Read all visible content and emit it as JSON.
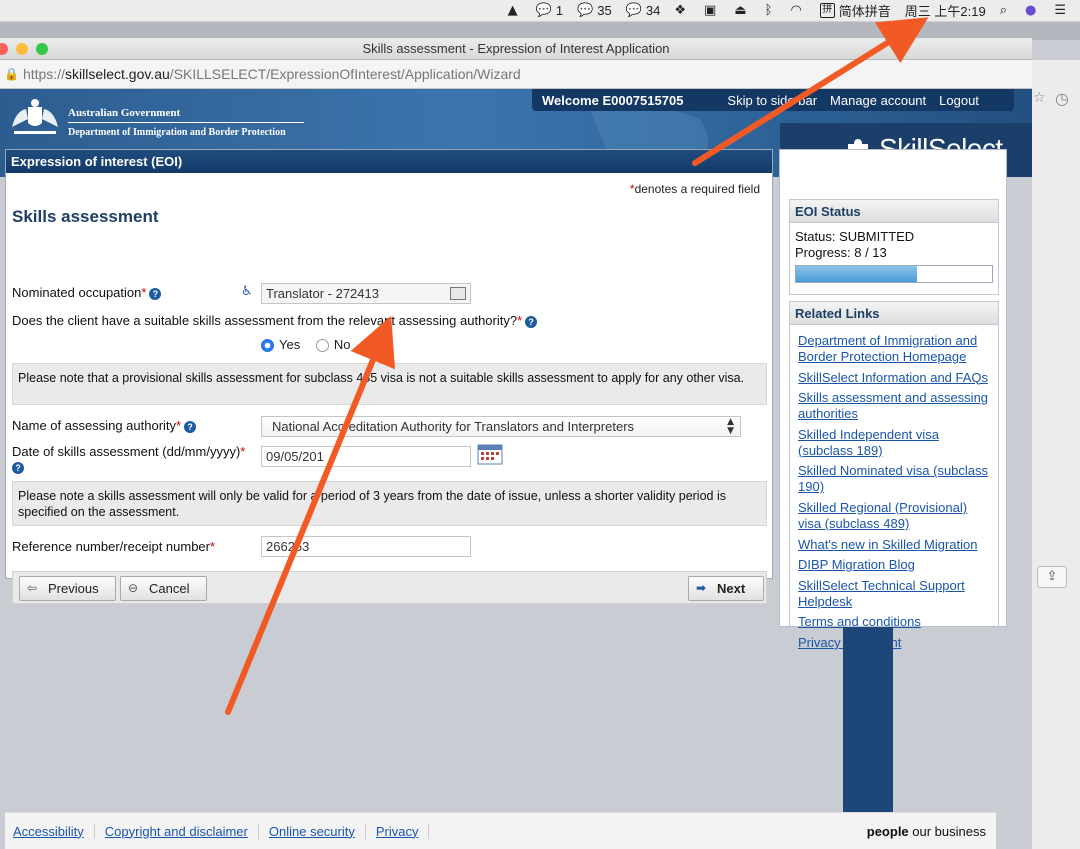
{
  "menubar": {
    "wechat_1": "1",
    "wechat_2": "35",
    "wechat_3": "34",
    "ime_glyph": "拼",
    "ime": "简体拼音",
    "clock": "周三 上午2:19"
  },
  "window": {
    "title": "Skills assessment - Expression of Interest Application",
    "url_scheme": "https://",
    "url_host": "skillselect.gov.au",
    "url_path": "/SKILLSELECT/ExpressionOfInterest/Application/Wizard"
  },
  "banner": {
    "govt": "Australian Government",
    "dept": "Department of Immigration and Border Protection",
    "welcome": "Welcome E0007515705",
    "links": [
      "Skip to side bar",
      "Manage account",
      "Logout"
    ],
    "brand": "SkillSelect"
  },
  "form": {
    "panel_title": "Expression of interest (EOI)",
    "required_note": "denotes a required field",
    "required_mark": "*",
    "section_title": "Skills assessment",
    "nominated_label": "Nominated occupation",
    "nominated_value": "Translator - 272413",
    "question": "Does the client have a suitable skills assessment from the relevant assessing authority?",
    "yes_label": "Yes",
    "no_label": "No",
    "yes_selected": true,
    "note1": "Please note that a provisional skills assessment for subclass 485 visa is not a suitable skills assessment to apply for any other visa.",
    "authority_label": "Name of assessing authority",
    "authority_value": "National Accreditation Authority for Translators and Interpreters",
    "date_label": "Date of skills assessment (dd/mm/yyyy)",
    "date_value": "09/05/201",
    "note2": "Please note a skills assessment will only be valid for a period of 3 years from the date of issue, unless a shorter validity period is specified on the assessment.",
    "ref_label": "Reference number/receipt number",
    "ref_value": "266253",
    "btn_previous": "Previous",
    "btn_cancel": "Cancel",
    "btn_next": "Next"
  },
  "eoi_status": {
    "title": "EOI Status",
    "status": "Status: SUBMITTED",
    "progress_text": "Progress: 8 / 13",
    "progress_fraction": 0.615
  },
  "related": {
    "title": "Related Links",
    "links": [
      "Department of Immigration and Border Protection Homepage",
      "SkillSelect Information and FAQs",
      "Skills assessment and assessing authorities",
      "Skilled Independent visa (subclass 189)",
      "Skilled Nominated visa (subclass 190)",
      "Skilled Regional (Provisional) visa (subclass 489)",
      "What's new in Skilled Migration",
      "DIBP Migration Blog",
      "SkillSelect Technical Support Helpdesk",
      "Terms and conditions",
      "Privacy statement"
    ]
  },
  "footer": {
    "links": [
      "Accessibility",
      "Copyright and disclaimer",
      "Online security",
      "Privacy"
    ],
    "tag_strong": "people",
    "tag_rest": " our business"
  },
  "colors": {
    "brand_blue": "#1e3f66",
    "link": "#1a56a8",
    "required": "#cc0000",
    "arrow": "#f15a24"
  }
}
